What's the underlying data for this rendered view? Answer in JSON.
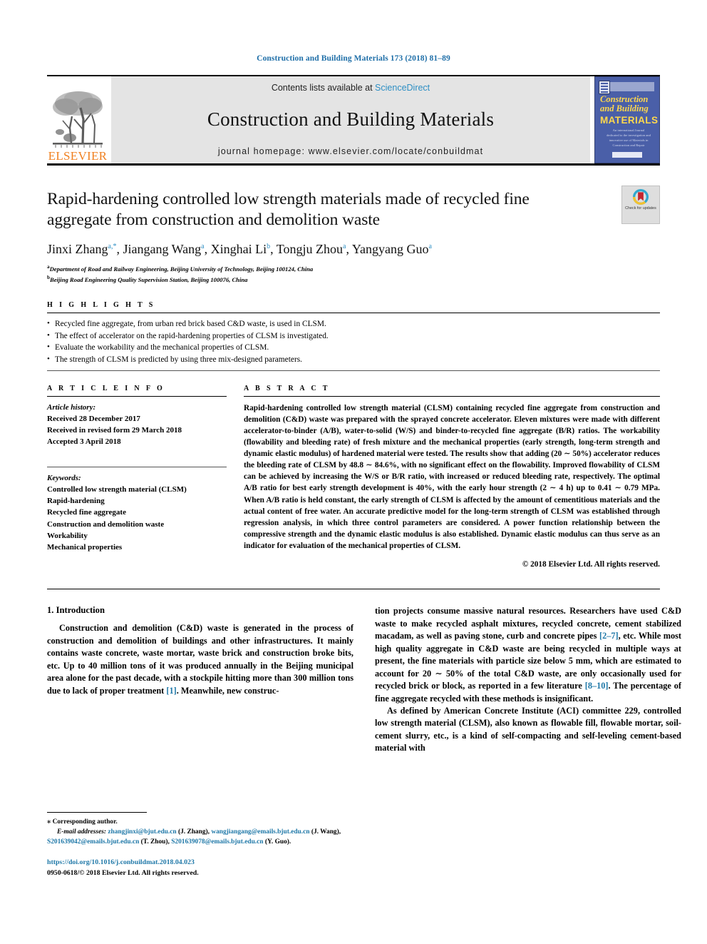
{
  "running_head": "Construction and Building Materials 173 (2018) 81–89",
  "masthead": {
    "publisher_name": "ELSEVIER",
    "contents_prefix": "Contents lists available at ",
    "contents_link": "ScienceDirect",
    "journal_title": "Construction and Building Materials",
    "homepage": "journal homepage: www.elsevier.com/locate/conbuildmat",
    "cover": {
      "line1": "Construction",
      "line2": "and Building",
      "line3": "MATERIALS",
      "blurb": "An international Journal dedicated to the investigation and innovative use of Materials in Construction and Repair"
    }
  },
  "article": {
    "title": "Rapid-hardening controlled low strength materials made of recycled fine aggregate from construction and demolition waste",
    "crossmark_label": "Check for updates",
    "authors_html": "Jinxi Zhang",
    "authors": [
      {
        "name": "Jinxi Zhang",
        "marks": "a,*"
      },
      {
        "name": "Jiangang Wang",
        "marks": "a"
      },
      {
        "name": "Xinghai Li",
        "marks": "b"
      },
      {
        "name": "Tongju Zhou",
        "marks": "a"
      },
      {
        "name": "Yangyang Guo",
        "marks": "a"
      }
    ],
    "affiliations": [
      {
        "mark": "a",
        "text": "Department of Road and Railway Engineering, Beijing University of Technology, Beijing 100124, China"
      },
      {
        "mark": "b",
        "text": "Beijing Road Engineering Quality Supervision Station, Beijing 100076, China"
      }
    ]
  },
  "highlights": {
    "heading": "H I G H L I G H T S",
    "items": [
      "Recycled fine aggregate, from urban red brick based C&D waste, is used in CLSM.",
      "The effect of accelerator on the rapid-hardening properties of CLSM is investigated.",
      "Evaluate the workability and the mechanical properties of CLSM.",
      "The strength of CLSM is predicted by using three mix-designed parameters."
    ]
  },
  "article_info": {
    "heading": "A R T I C L E    I N F O",
    "history_label": "Article history:",
    "history": [
      "Received 28 December 2017",
      "Received in revised form 29 March 2018",
      "Accepted 3 April 2018"
    ],
    "keywords_label": "Keywords:",
    "keywords": [
      "Controlled low strength material (CLSM)",
      "Rapid-hardening",
      "Recycled fine aggregate",
      "Construction and demolition waste",
      "Workability",
      "Mechanical properties"
    ]
  },
  "abstract": {
    "heading": "A B S T R A C T",
    "text": "Rapid-hardening controlled low strength material (CLSM) containing recycled fine aggregate from construction and demolition (C&D) waste was prepared with the sprayed concrete accelerator. Eleven mixtures were made with different accelerator-to-binder (A/B), water-to-solid (W/S) and binder-to-recycled fine aggregate (B/R) ratios. The workability (flowability and bleeding rate) of fresh mixture and the mechanical properties (early strength, long-term strength and dynamic elastic modulus) of hardened material were tested. The results show that adding (20 ∼ 50%) accelerator reduces the bleeding rate of CLSM by 48.8 ∼ 84.6%, with no significant effect on the flowability. Improved flowability of CLSM can be achieved by increasing the W/S or B/R ratio, with increased or reduced bleeding rate, respectively. The optimal A/B ratio for best early strength development is 40%, with the early hour strength (2 ∼ 4 h) up to 0.41 ∼ 0.79 MPa. When A/B ratio is held constant, the early strength of CLSM is affected by the amount of cementitious materials and the actual content of free water. An accurate predictive model for the long-term strength of CLSM was established through regression analysis, in which three control parameters are considered. A power function relationship between the compressive strength and the dynamic elastic modulus is also established. Dynamic elastic modulus can thus serve as an indicator for evaluation of the mechanical properties of CLSM.",
    "copyright": "© 2018 Elsevier Ltd. All rights reserved."
  },
  "body": {
    "section_heading": "1. Introduction",
    "left_paragraph": "Construction and demolition (C&D) waste is generated in the process of construction and demolition of buildings and other infrastructures. It mainly contains waste concrete, waste mortar, waste brick and construction broke bits, etc. Up to 40 million tons of it was produced annually in the Beijing municipal area alone for the past decade, with a stockpile hitting more than 300 million tons due to lack of proper treatment [1]. Meanwhile, new construc-",
    "right_paragraph_1": "tion projects consume massive natural resources. Researchers have used C&D waste to make recycled asphalt mixtures, recycled concrete, cement stabilized macadam, as well as paving stone, curb and concrete pipes [2–7], etc. While most high quality aggregate in C&D waste are being recycled in multiple ways at present, the fine materials with particle size below 5 mm, which are estimated to account for 20 ∼ 50% of the total C&D waste, are only occasionally used for recycled brick or block, as reported in a few literature [8–10]. The percentage of fine aggregate recycled with these methods is insignificant.",
    "right_paragraph_2": "As defined by American Concrete Institute (ACI) committee 229, controlled low strength material (CLSM), also known as flowable fill, flowable mortar, soil-cement slurry, etc., is a kind of self-compacting and self-leveling cement-based material with",
    "ref_1": "[1]",
    "ref_2_7": "[2–7]",
    "ref_8_10": "[8–10]"
  },
  "footnotes": {
    "corresponding": "Corresponding author.",
    "email_label": "E-mail addresses:",
    "emails": [
      {
        "address": "zhangjinxi@bjut.edu.cn",
        "who": "(J. Zhang),"
      },
      {
        "address": "wangjiangang@emails.bjut.edu.cn",
        "who": "(J. Wang),"
      },
      {
        "address": "S201639042@emails.bjut.edu.cn",
        "who": "(T. Zhou),"
      },
      {
        "address": "S201639078@emails.bjut.edu.cn",
        "who": "(Y. Guo)."
      }
    ],
    "doi": "https://doi.org/10.1016/j.conbuildmat.2018.04.023",
    "issn_line": "0950-0618/© 2018 Elsevier Ltd. All rights reserved."
  },
  "colors": {
    "link_blue": "#1f78a8",
    "header_blue": "#1f6fa8",
    "sciencedirect_blue": "#2e8fc4",
    "elsevier_orange": "#F08020",
    "band_gray": "#e4e4e4",
    "cover_blue": "#4a5fa8",
    "cover_yellow": "#ffd84d"
  }
}
